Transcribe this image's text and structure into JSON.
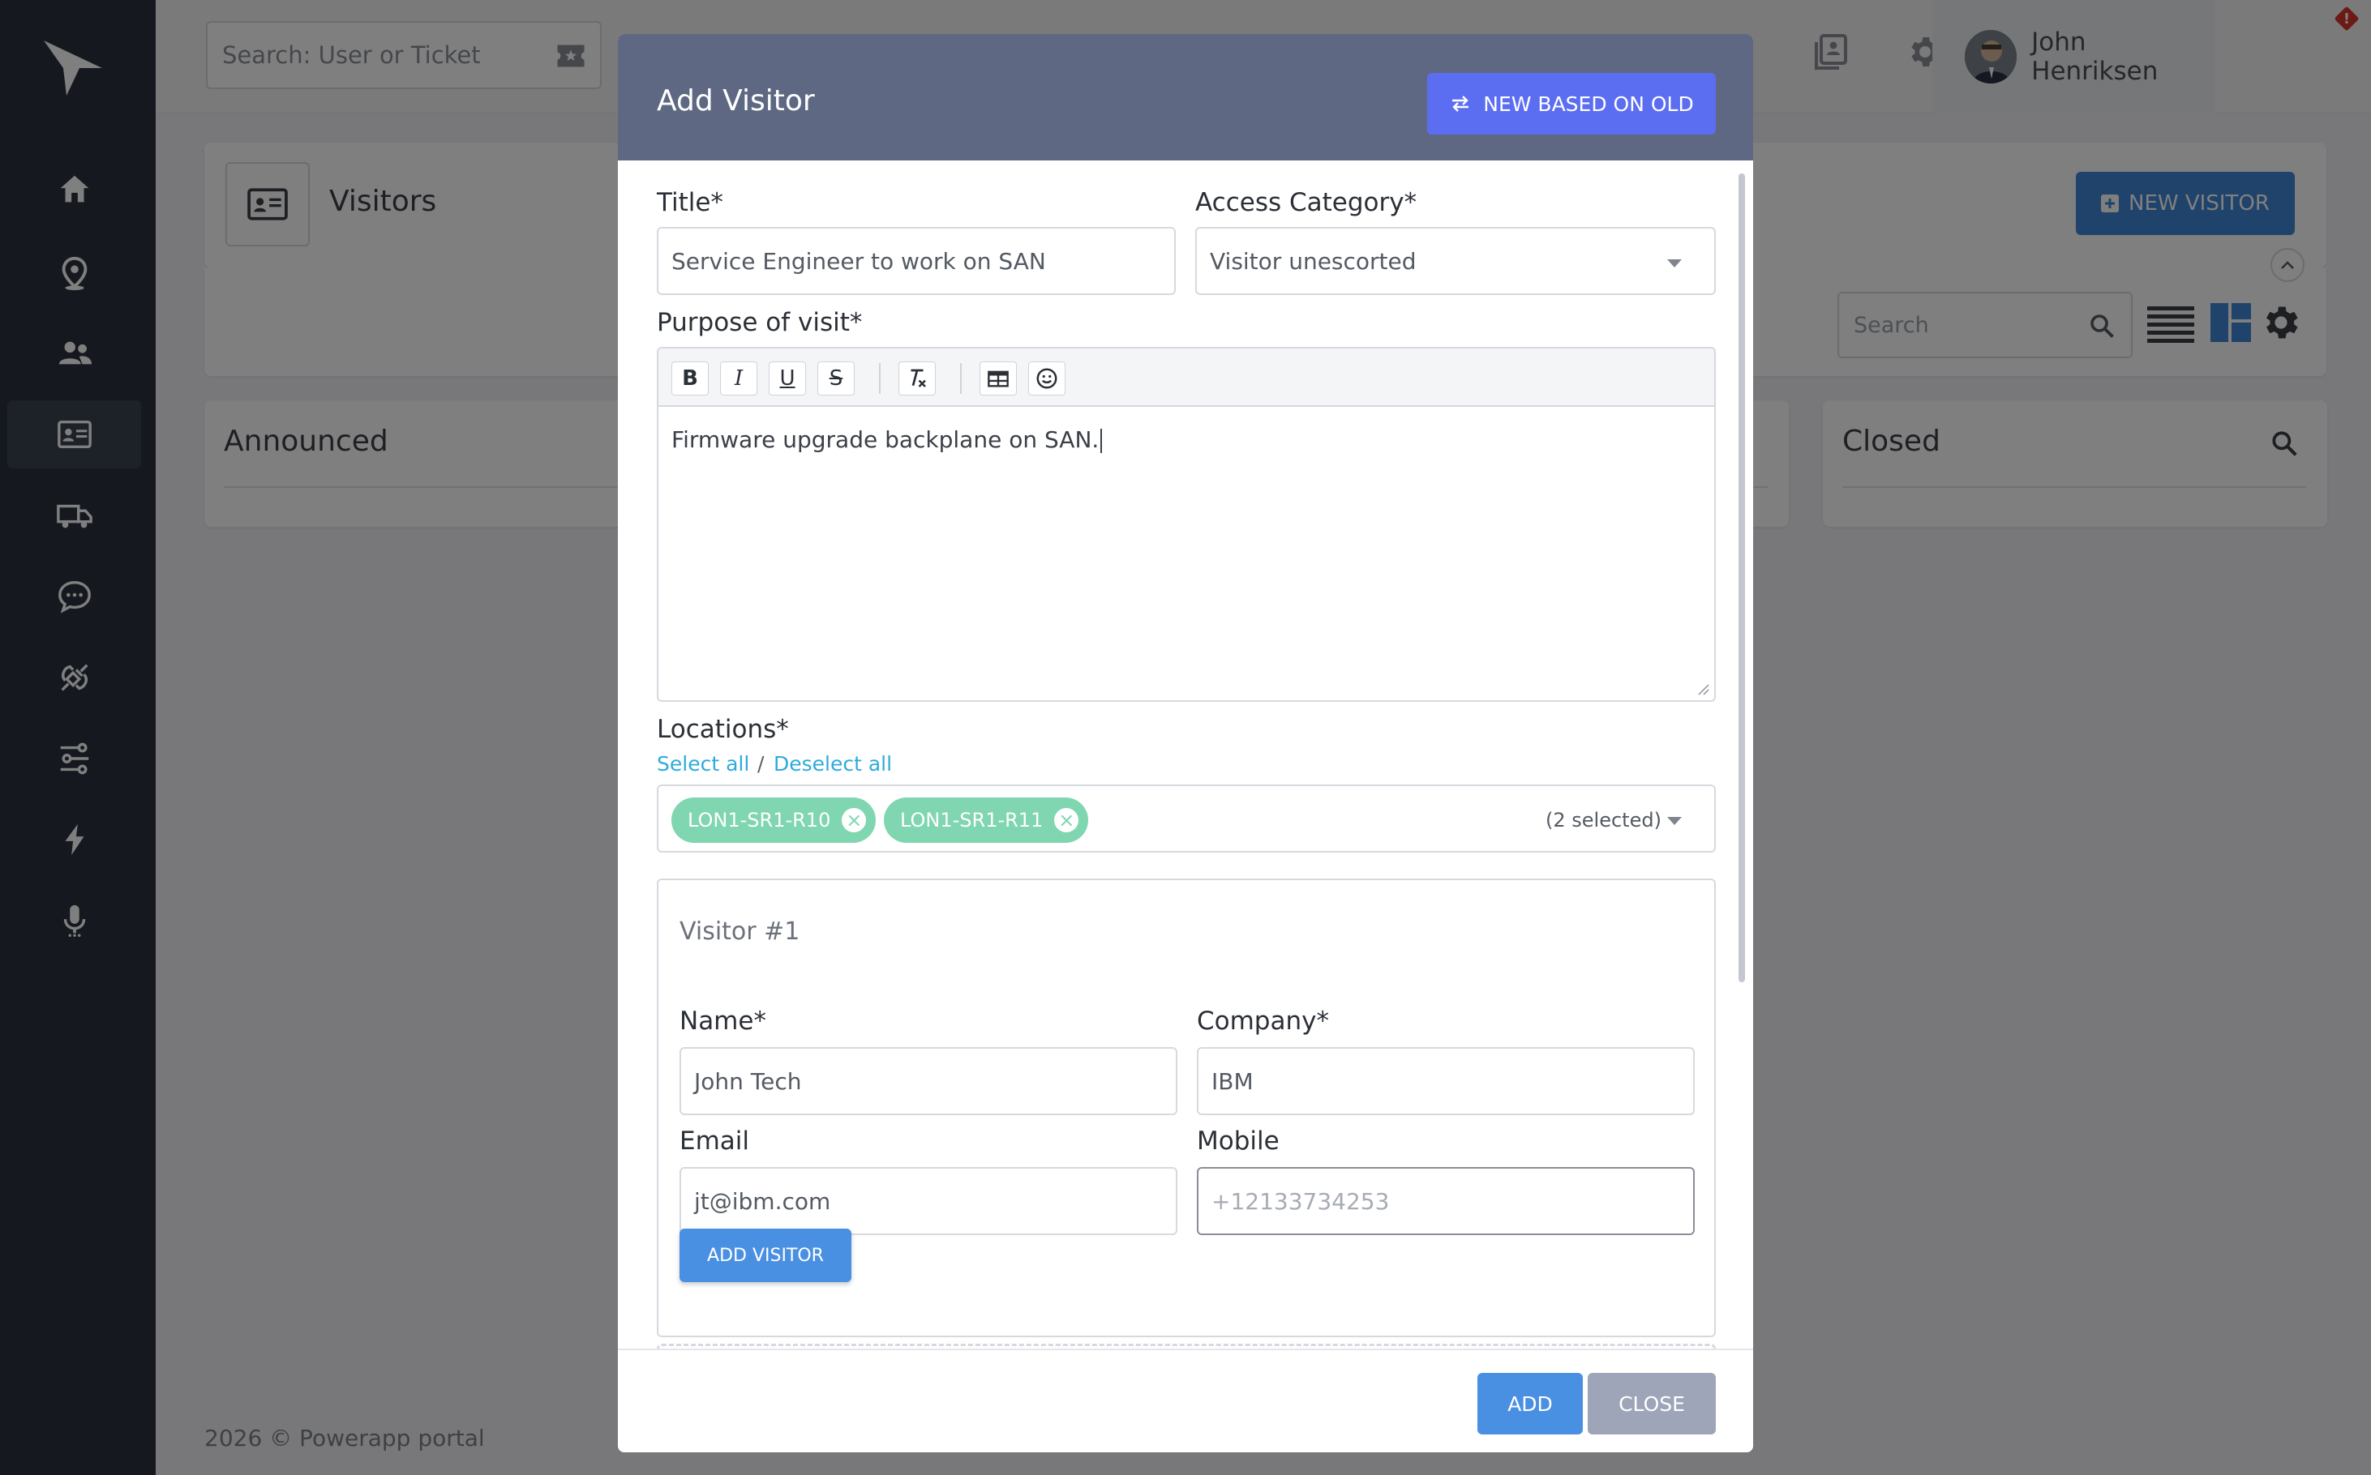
{
  "colors": {
    "sidebar": "#2b313d",
    "accent": "#4a90e2",
    "modal_header": "#5e6882",
    "tag": "#7fd6b0",
    "new_based_btn": "#5b6ef2"
  },
  "sidebar": {
    "items": [
      {
        "name": "home",
        "icon": "home-icon"
      },
      {
        "name": "locations",
        "icon": "map-pin-icon"
      },
      {
        "name": "users",
        "icon": "users-icon"
      },
      {
        "name": "visitors",
        "icon": "id-card-icon",
        "active": true
      },
      {
        "name": "deliveries",
        "icon": "truck-icon"
      },
      {
        "name": "messages",
        "icon": "chat-icon"
      },
      {
        "name": "integrations",
        "icon": "plug-icon"
      },
      {
        "name": "workflows",
        "icon": "flow-icon"
      },
      {
        "name": "events",
        "icon": "bolt-icon"
      },
      {
        "name": "voice",
        "icon": "microphone-icon"
      }
    ]
  },
  "topbar": {
    "search_placeholder": "Search: User or Ticket",
    "user_name": "John Henriksen",
    "alert_badge": "!"
  },
  "page": {
    "title": "Visitors",
    "new_visitor_label": "NEW VISITOR",
    "search_placeholder": "Search",
    "columns": [
      "Announced",
      "Closed"
    ]
  },
  "footer": {
    "text": "2026 © Powerapp portal"
  },
  "modal": {
    "title": "Add Visitor",
    "new_based_on_old_label": "NEW BASED ON OLD",
    "title_label": "Title*",
    "title_value": "Service Engineer to work on SAN",
    "access_category_label": "Access Category*",
    "access_category_value": "Visitor unescorted",
    "purpose_label": "Purpose of visit*",
    "purpose_value": "Firmware upgrade backplane on SAN.",
    "locations_label": "Locations*",
    "select_all": "Select all",
    "deselect_all": "Deselect all",
    "separator": "/",
    "locations": [
      "LON1-SR1-R10",
      "LON1-SR1-R11"
    ],
    "selected_count": "(2 selected)",
    "visitor": {
      "heading": "Visitor #1",
      "name_label": "Name*",
      "name_value": "John Tech",
      "company_label": "Company*",
      "company_value": "IBM",
      "email_label": "Email",
      "email_value": "jt@ibm.com",
      "mobile_label": "Mobile",
      "mobile_placeholder": "+12133734253",
      "add_visitor_label": "ADD VISITOR"
    },
    "add_label": "ADD",
    "close_label": "CLOSE"
  }
}
